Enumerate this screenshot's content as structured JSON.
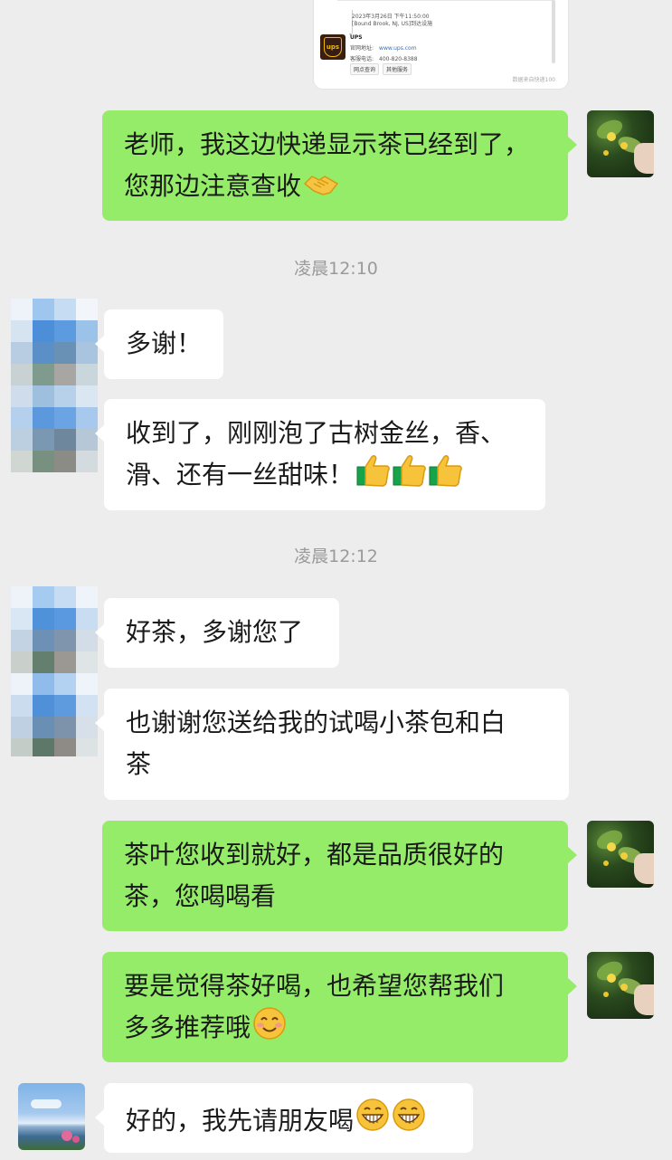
{
  "shared_card": {
    "track_time": "2023年3月26日 下午11:50:00",
    "track_place": "[Bound Brook, NJ, US]到达设施",
    "carrier_name": "UPS",
    "website_label": "官网地址:",
    "website_value": "www.ups.com",
    "phone_label": "客服电话:",
    "phone_value": "400-820-8388",
    "button_1": "网点查询",
    "button_2": "其他服务",
    "footer": "数据来自快递100",
    "logo_text": "ups"
  },
  "timestamps": {
    "t1": "凌晨12:10",
    "t2": "凌晨12:12"
  },
  "messages": {
    "m1": "老师，我这边快递显示茶已经到了，\n您那边注意查收",
    "m2": "多谢！",
    "m3": "收到了，刚刚泡了古树金丝，香、\n滑、还有一丝甜味！",
    "m4": "好茶，多谢您了",
    "m5": "也谢谢您送给我的试喝小茶包和白\n茶",
    "m6": "茶叶您收到就好，都是品质很好的\n茶，您喝喝看",
    "m7": "要是觉得茶好喝，也希望您帮我们\n多多推荐哦",
    "m8": "好的，我先请朋友喝"
  },
  "emoji_names": {
    "m1": "handshake-emoji",
    "m3": "thumbs-up-emoji",
    "m7": "smiling-blush-emoji",
    "m8": "grinning-emoji"
  },
  "colors": {
    "outgoing_bubble": "#95ec69",
    "incoming_bubble": "#ffffff",
    "background": "#ededed",
    "timestamp": "#9a9a9a"
  }
}
